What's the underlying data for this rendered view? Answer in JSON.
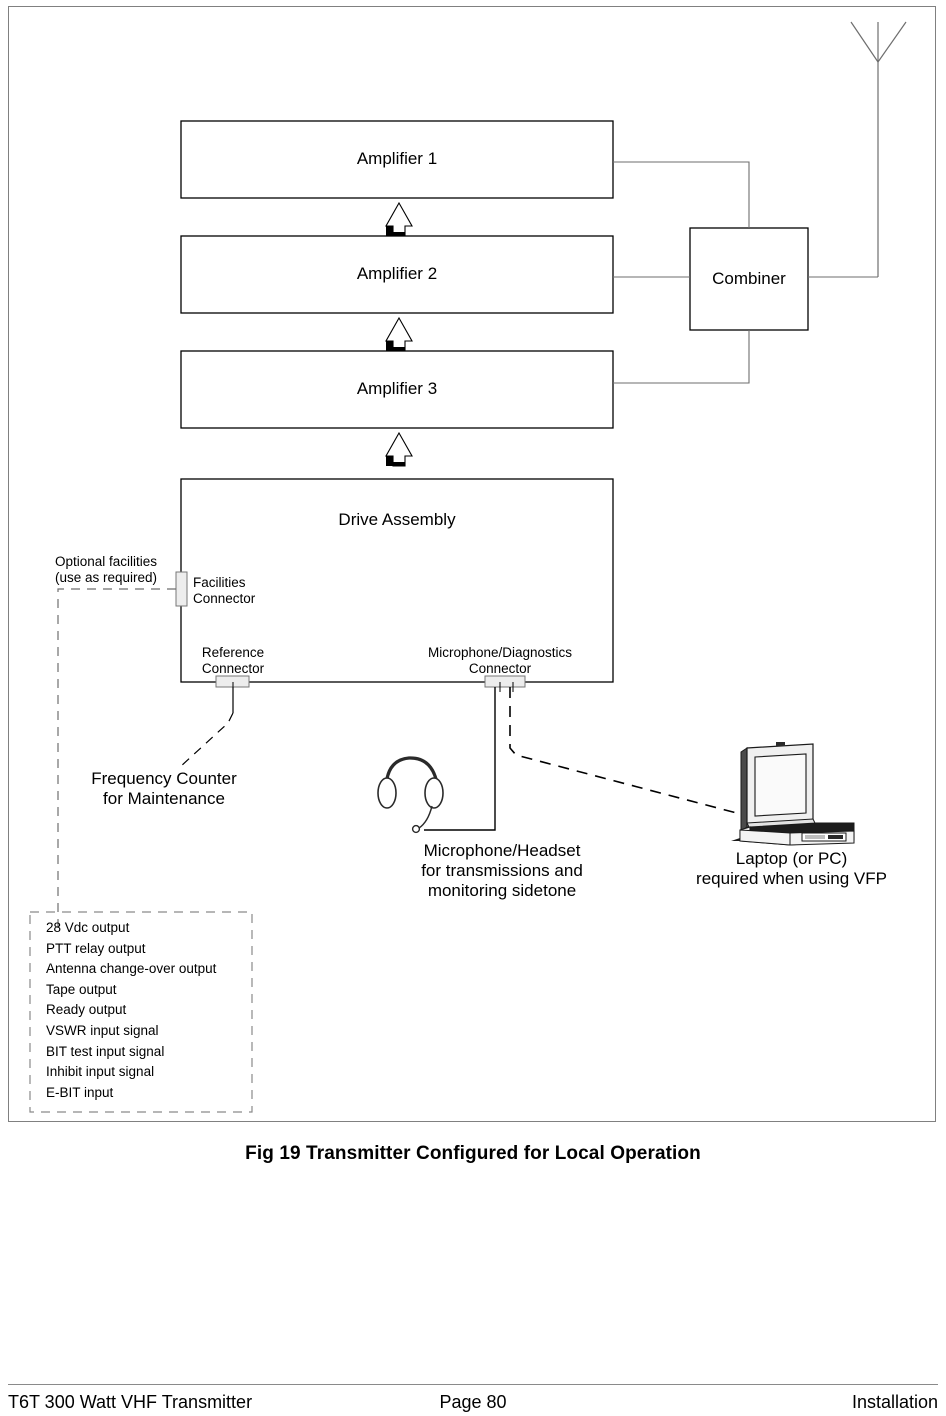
{
  "document": {
    "figure_caption": "Fig 19  Transmitter Configured for Local Operation",
    "footer": {
      "left": "T6T 300 Watt VHF Transmitter",
      "center": "Page 80",
      "right": "Installation"
    }
  },
  "diagram": {
    "blocks": {
      "amplifier1": "Amplifier 1",
      "amplifier2": "Amplifier 2",
      "amplifier3": "Amplifier 3",
      "drive_assembly": "Drive Assembly",
      "combiner": "Combiner"
    },
    "connectors": {
      "facilities": "Facilities\nConnector",
      "reference": "Reference\nConnector",
      "microphone_diagnostics": "Microphone/Diagnostics\nConnector"
    },
    "notes": {
      "optional_facilities": "Optional facilities\n(use as required)",
      "frequency_counter": "Frequency Counter\nfor Maintenance",
      "microphone_headset": "Microphone/Headset\nfor transmissions and\nmonitoring sidetone",
      "laptop": "Laptop (or PC)\nrequired when using VFP"
    },
    "facilities_list": [
      "28 Vdc output",
      "PTT relay output",
      "Antenna change-over output",
      "Tape output",
      "Ready output",
      "VSWR input signal",
      "BIT test input signal",
      "Inhibit input signal",
      "E-BIT input"
    ],
    "icons": {
      "antenna": "antenna-icon",
      "laptop": "laptop-icon",
      "headset": "headset-icon",
      "uparrow": "up-arrow-icon"
    },
    "colors": {
      "line": "#000000",
      "thin_line": "#6e6e6e",
      "connector_fill": "#ededed",
      "frame": "#808080",
      "background": "#ffffff"
    }
  }
}
